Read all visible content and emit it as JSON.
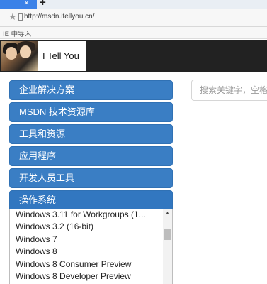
{
  "browser": {
    "tab_close": "×",
    "new_tab": "+",
    "url": "http://msdn.itellyou.cn/",
    "favorites_label": "IE 中导入"
  },
  "site": {
    "logo_text": "I Tell You"
  },
  "nav": {
    "items": [
      {
        "label": "企业解决方案"
      },
      {
        "label": "MSDN 技术资源库"
      },
      {
        "label": "工具和资源"
      },
      {
        "label": "应用程序"
      },
      {
        "label": "开发人员工具"
      },
      {
        "label": "操作系统"
      }
    ],
    "os_list": [
      "Windows 3.11 for Workgroups (1...",
      "Windows 3.2 (16-bit)",
      "Windows 7",
      "Windows 8",
      "Windows 8 Consumer Preview",
      "Windows 8 Developer Preview"
    ]
  },
  "search": {
    "placeholder": "搜索关键字，空格"
  },
  "colors": {
    "nav_blue": "#3a7ec4",
    "header_bg": "#222222",
    "tab_blue": "#3b82e8"
  }
}
